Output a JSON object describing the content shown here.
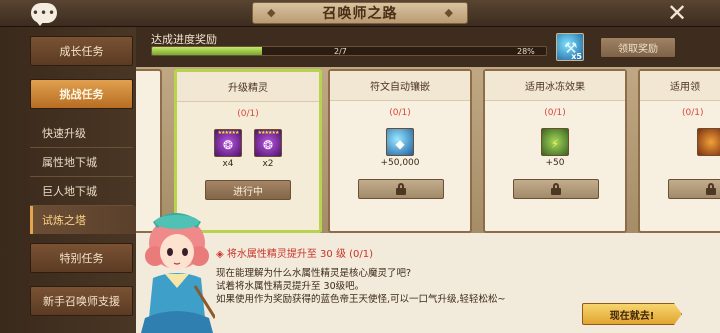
{
  "header": {
    "title": "召唤师之路",
    "chat_icon": "chat-bubble-icon",
    "close_icon": "close-x-icon"
  },
  "sidebar": {
    "growth": "成长任务",
    "challenge": "挑战任务",
    "sub_items": [
      "快速升级",
      "属性地下城",
      "巨人地下城",
      "试炼之塔"
    ],
    "special": "特别任务",
    "newbie": "新手召唤师支援"
  },
  "progress": {
    "label": "达成进度奖励",
    "count": "2/7",
    "percent_text": "28%",
    "fraction": 0.28,
    "reward_qty": "x5",
    "claim_label": "领取奖励"
  },
  "cards": [
    {
      "title": "升级精灵",
      "progress": "(0/1)",
      "rewards": [
        {
          "icon": "purple-monster-icon",
          "stars": "★★★★★★",
          "qty": "x4"
        },
        {
          "icon": "purple-monster-icon",
          "stars": "★★★★★★",
          "qty": "x2"
        }
      ],
      "button": "进行中",
      "locked": false
    },
    {
      "title": "符文自动镶嵌",
      "progress": "(0/1)",
      "rewards": [
        {
          "icon": "crystal-icon",
          "qty": "+50,000"
        }
      ],
      "button": "",
      "locked": true
    },
    {
      "title": "适用冰冻效果",
      "progress": "(0/1)",
      "rewards": [
        {
          "icon": "energy-icon",
          "qty": "+50"
        }
      ],
      "button": "",
      "locked": true
    },
    {
      "title": "适用领",
      "progress": "(0/1)",
      "rewards": [],
      "button": "",
      "locked": true
    }
  ],
  "detail": {
    "title": "◈ 将水属性精灵提升至 30 级 (0/1)",
    "lines": [
      "现在能理解为什么水属性精灵是核心魔灵了吧?",
      "试着将水属性精灵提升至 30级吧。",
      "如果使用作为奖励获得的蓝色帝王天使怪,可以一口气升级,轻轻松松~"
    ],
    "go_label": "现在就去!"
  }
}
